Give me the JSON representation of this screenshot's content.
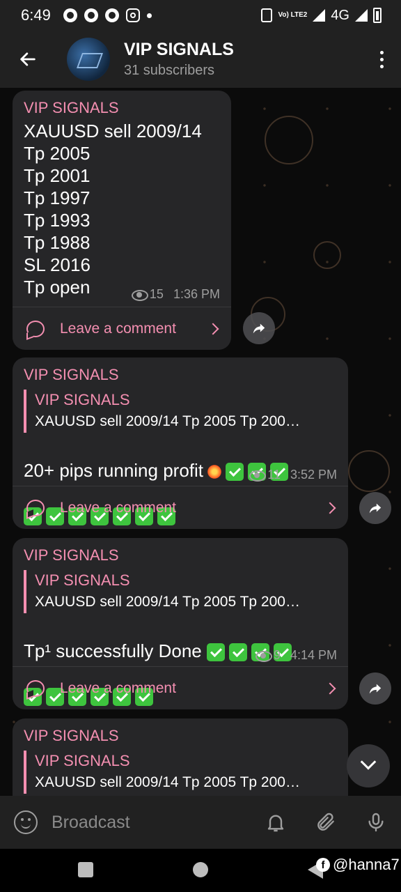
{
  "status_bar": {
    "time": "6:49",
    "network": "4G",
    "volte": "Vo) LTE2"
  },
  "header": {
    "title": "VIP SIGNALS",
    "subtitle": "31 subscribers",
    "icons": [
      "back-arrow-icon",
      "more-vertical-icon"
    ]
  },
  "messages": [
    {
      "author": "VIP SIGNALS",
      "text": "XAUUSD sell 2009/14\nTp 2005\nTp 2001\nTp 1997\nTp 1993\nTp 1988\nSL 2016\nTp open",
      "views": "15",
      "time": "1:36 PM",
      "comment_label": "Leave a comment"
    },
    {
      "author": "VIP SIGNALS",
      "reply_author": "VIP SIGNALS",
      "reply_text": "XAUUSD sell 2009/14 Tp 2005 Tp 200…",
      "text": "20+ pips running profit",
      "views": "11",
      "time": "3:52 PM",
      "comment_label": "Leave a comment"
    },
    {
      "author": "VIP SIGNALS",
      "reply_author": "VIP SIGNALS",
      "reply_text": "XAUUSD sell 2009/14 Tp 2005 Tp 200…",
      "text": "Tp¹ successfully Done",
      "views": "9",
      "time": "4:14 PM",
      "comment_label": "Leave a comment"
    },
    {
      "author": "VIP SIGNALS",
      "reply_author": "VIP SIGNALS",
      "reply_text": "XAUUSD sell 2009/14 Tp 2005 Tp 200…"
    }
  ],
  "input": {
    "placeholder": "Broadcast"
  },
  "watermark": "@hanna7",
  "colors": {
    "accent": "#f48fb1",
    "bubble": "#262628",
    "bar": "#212121"
  }
}
